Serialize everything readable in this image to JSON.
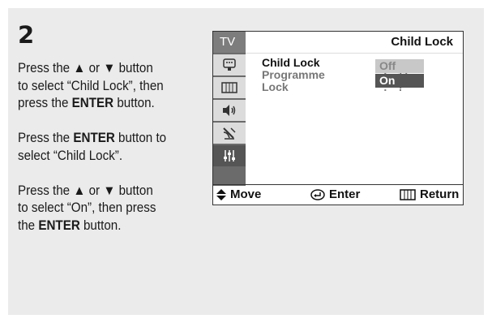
{
  "step": {
    "number": "2"
  },
  "instructions": {
    "p1": {
      "line1_a": "Press the ",
      "up_arrow": "▲",
      "line1_b": " or ",
      "down_arrow": "▼",
      "line1_c": " button",
      "line2": "to select “Child Lock”, then",
      "line3_a": "press the ",
      "line3_bold": "ENTER",
      "line3_b": " button."
    },
    "p2": {
      "line1_a": "Press the ",
      "line1_bold": "ENTER",
      "line1_b": " button to",
      "line2": "select “Child Lock”."
    },
    "p3": {
      "line1_a": "Press the ",
      "up_arrow": "▲",
      "line1_b": " or ",
      "down_arrow": "▼",
      "line1_c": " button",
      "line2": "to select “On”, then press",
      "line3_a": "the ",
      "line3_bold": "ENTER",
      "line3_b": " button."
    }
  },
  "tv_menu": {
    "sidebar_label": "TV",
    "title": "Child Lock",
    "rows": [
      {
        "label": "Child Lock",
        "colon": ":"
      },
      {
        "label": "Programme",
        "colon": ":",
        "value": "11"
      },
      {
        "label": "Lock",
        "colon": ":",
        "value": "?"
      }
    ],
    "options": {
      "off": "Off",
      "on": "On"
    },
    "footer": {
      "move": "Move",
      "enter": "Enter",
      "return": "Return"
    },
    "sidebar_icons": [
      "picture-icon",
      "menu-icon",
      "speaker-icon",
      "antenna-icon",
      "setup-icon"
    ]
  }
}
